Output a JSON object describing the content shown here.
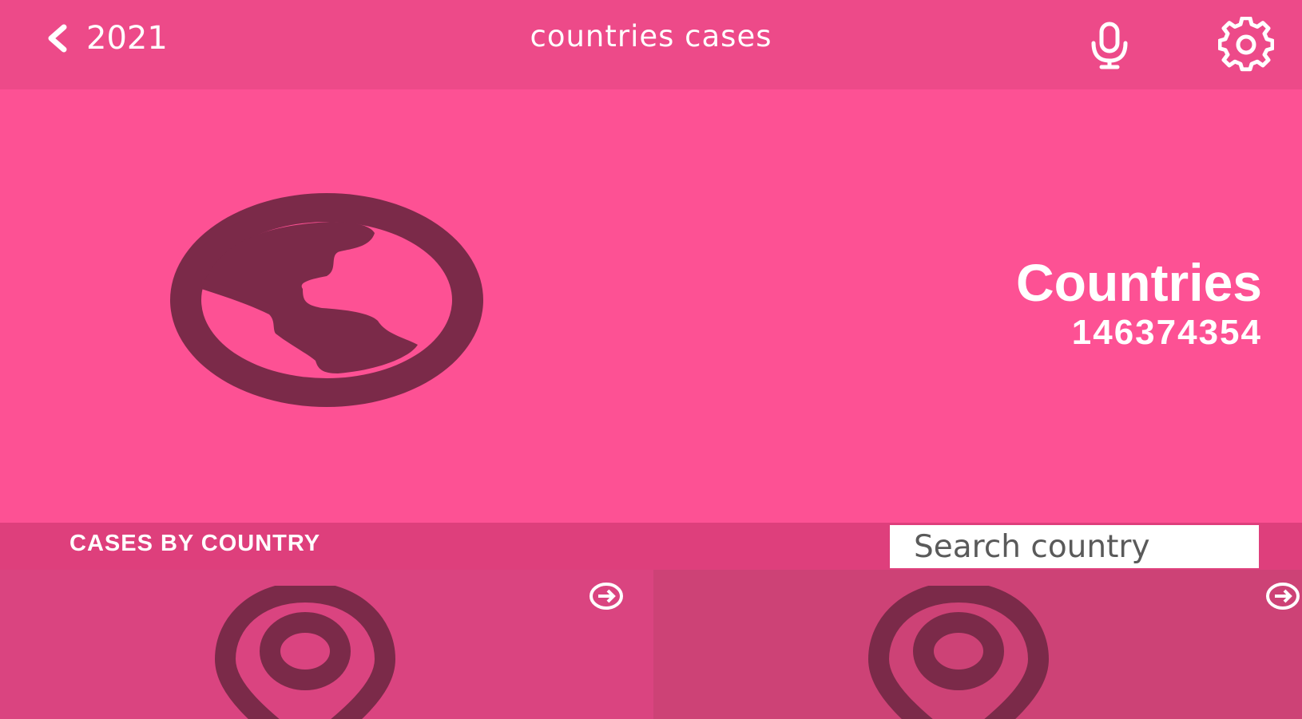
{
  "header": {
    "back_label": "2021",
    "title": "countries cases",
    "icons": {
      "back": "chevron-left-icon",
      "mic": "microphone-icon",
      "settings": "gear-icon"
    }
  },
  "hero": {
    "title": "Countries",
    "count": "146374354",
    "icon": "globe-icon"
  },
  "section": {
    "title": "CASES BY COUNTRY",
    "search_placeholder": "Search country"
  },
  "tiles": [
    {
      "icon": "location-pin-icon",
      "action_icon": "arrow-right-circle-icon"
    },
    {
      "icon": "location-pin-icon",
      "action_icon": "arrow-right-circle-icon"
    }
  ],
  "colors": {
    "header_bg": "#ed4a89",
    "hero_bg": "#fd5194",
    "section_bg": "#de3f7c",
    "tile_1_bg": "#da4480",
    "tile_2_bg": "#cd4276",
    "icon_dark": "#7b2a49",
    "text": "#ffffff"
  }
}
